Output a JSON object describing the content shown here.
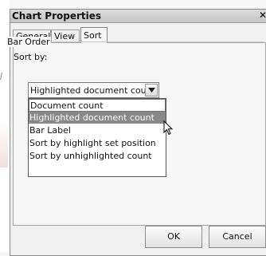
{
  "dialog": {
    "title": "Chart Properties",
    "close_symbol": "✕"
  },
  "tabs": [
    {
      "label": "General"
    },
    {
      "label": "View"
    },
    {
      "label": "Sort",
      "active": true
    }
  ],
  "sort_panel": {
    "group_label": "Bar Order",
    "sort_by_label": "Sort by:",
    "combo_value": "Highlighted document count",
    "options": [
      {
        "label": "Document count"
      },
      {
        "label": "Highlighted document count",
        "selected": true
      },
      {
        "label": "Bar Label"
      },
      {
        "label": "Sort by highlight set position"
      },
      {
        "label": "Sort by unhighlighted count"
      }
    ]
  },
  "buttons": {
    "ok": "OK",
    "cancel": "Cancel"
  },
  "icons": {
    "close": "close-icon",
    "dropdown_arrow": "chevron-down-icon",
    "cursor": "mouse-pointer-icon"
  },
  "colors": {
    "selected_option_bg": "#888888",
    "dialog_bg": "#f0f0f0"
  }
}
